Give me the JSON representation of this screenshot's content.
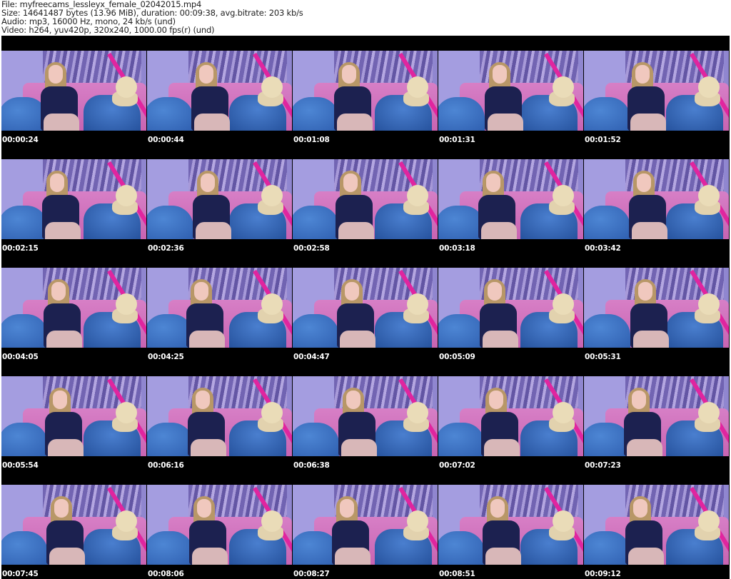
{
  "header": {
    "file": "File: myfreecams_lessleyx_female_02042015.mp4",
    "size": "Size: 14641487 bytes (13.96 MiB), duration: 00:09:38, avg.bitrate: 203 kb/s",
    "audio": "Audio: mp3, 16000 Hz, mono, 24 kb/s (und)",
    "video": "Video: h264, yuv420p, 320x240, 1000.00 fps(r) (und)"
  },
  "thumbnails": [
    "00:00:24",
    "00:00:44",
    "00:01:08",
    "00:01:31",
    "00:01:52",
    "00:02:15",
    "00:02:36",
    "00:02:58",
    "00:03:18",
    "00:03:42",
    "00:04:05",
    "00:04:25",
    "00:04:47",
    "00:05:09",
    "00:05:31",
    "00:05:54",
    "00:06:16",
    "00:06:38",
    "00:07:02",
    "00:07:23",
    "00:07:45",
    "00:08:06",
    "00:08:27",
    "00:08:51",
    "00:09:12"
  ]
}
